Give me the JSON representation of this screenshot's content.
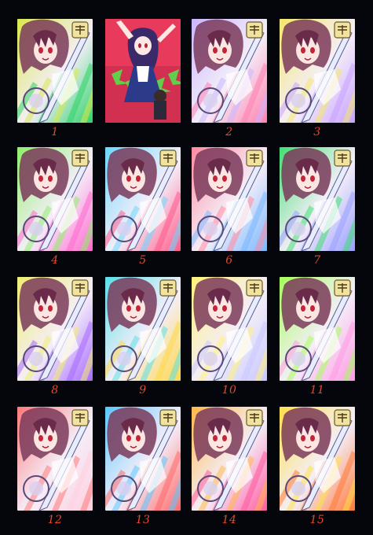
{
  "sheet": {
    "background": "#05060b",
    "label_color": "#e24a2e",
    "panels": [
      {
        "label": "1",
        "kind": "sample",
        "tint": "#d9e84a",
        "accent": "#2fd36a"
      },
      {
        "label": "",
        "kind": "reference",
        "tint": "#e83a5a",
        "accent": "#56e04a"
      },
      {
        "label": "2",
        "kind": "sample",
        "tint": "#c9b6ff",
        "accent": "#ff7fb0"
      },
      {
        "label": "3",
        "kind": "sample",
        "tint": "#f4e86a",
        "accent": "#c8a2ff"
      },
      {
        "label": "4",
        "kind": "sample",
        "tint": "#8ef06a",
        "accent": "#ff6ad0"
      },
      {
        "label": "5",
        "kind": "sample",
        "tint": "#6ad8ff",
        "accent": "#ff5a8a"
      },
      {
        "label": "6",
        "kind": "sample",
        "tint": "#ff8aa0",
        "accent": "#7ab8ff"
      },
      {
        "label": "7",
        "kind": "sample",
        "tint": "#3fe070",
        "accent": "#9aa0ff"
      },
      {
        "label": "8",
        "kind": "sample",
        "tint": "#f0ee70",
        "accent": "#a86aff"
      },
      {
        "label": "9",
        "kind": "sample",
        "tint": "#5ae0e8",
        "accent": "#ffd84a"
      },
      {
        "label": "10",
        "kind": "sample",
        "tint": "#fff27a",
        "accent": "#c8c8ff"
      },
      {
        "label": "11",
        "kind": "sample",
        "tint": "#a6ff5a",
        "accent": "#ff9ae6"
      },
      {
        "label": "12",
        "kind": "sample",
        "tint": "#ff7a7a",
        "accent": "#ffd0e0"
      },
      {
        "label": "13",
        "kind": "sample",
        "tint": "#5ac8ff",
        "accent": "#ff6a6a"
      },
      {
        "label": "14",
        "kind": "sample",
        "tint": "#ffb84a",
        "accent": "#ff5aa0"
      },
      {
        "label": "15",
        "kind": "sample",
        "tint": "#ffe04a",
        "accent": "#ff7a3a"
      }
    ]
  }
}
